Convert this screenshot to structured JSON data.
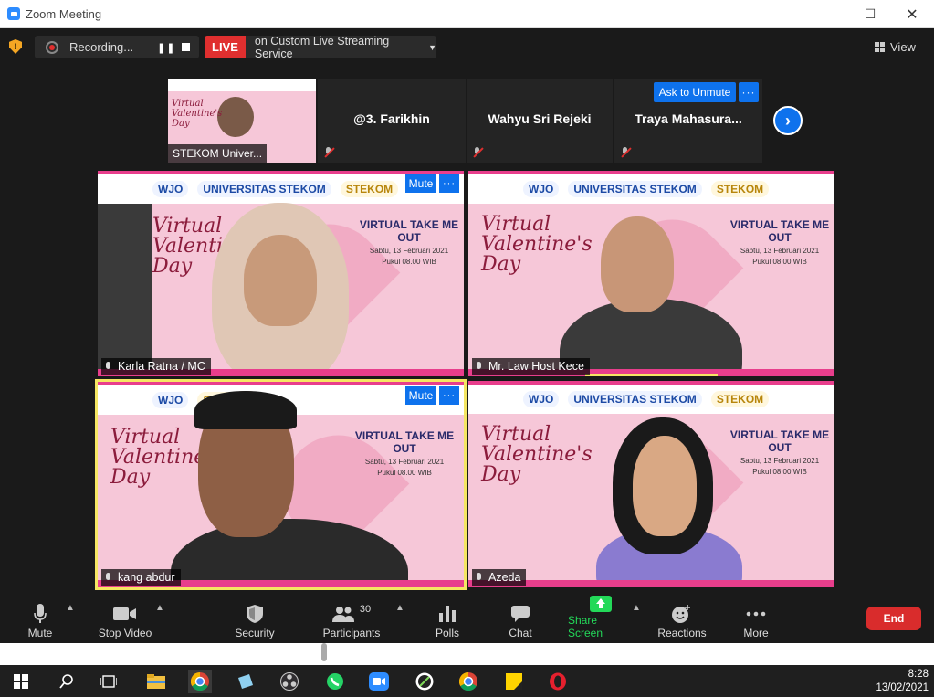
{
  "window": {
    "title": "Zoom Meeting"
  },
  "topbar": {
    "recording_label": "Recording...",
    "live_badge": "LIVE",
    "live_text": "on Custom Live Streaming Service",
    "view_label": "View"
  },
  "strip": {
    "tiles": [
      {
        "name": "STEKOM Univer..."
      },
      {
        "name": "@3. Farikhin"
      },
      {
        "name": "Wahyu Sri Rejeki"
      },
      {
        "name": "Traya  Mahasura..."
      }
    ],
    "ask_to_unmute": "Ask to Unmute"
  },
  "banner": {
    "logo_wjo": "WJO",
    "logo_univ": "UNIVERSITAS STEKOM",
    "logo_stekom": "STEKOM",
    "script": "Virtual Valentine's Day",
    "event_title": "VIRTUAL TAKE ME OUT",
    "event_date": "Sabtu, 13 Februari 2021",
    "event_time": "Pukul 08.00 WIB"
  },
  "videos": [
    {
      "name": "Karla Ratna / MC",
      "mute": "Mute"
    },
    {
      "name": "Mr. Law Host Kece"
    },
    {
      "name": "kang abdur",
      "mute": "Mute"
    },
    {
      "name": "Azeda"
    }
  ],
  "toolbar": {
    "mute": "Mute",
    "stop_video": "Stop Video",
    "security": "Security",
    "participants": "Participants",
    "participants_count": "30",
    "polls": "Polls",
    "chat": "Chat",
    "share_screen": "Share Screen",
    "reactions": "Reactions",
    "more": "More",
    "end": "End"
  },
  "taskbar": {
    "time": "8:28",
    "date": "13/02/2021"
  },
  "colors": {
    "zoom_blue": "#0e72ed",
    "live_red": "#e02f2f",
    "share_green": "#23d959",
    "end_red": "#d92c2c",
    "banner_pink": "#e83e8c"
  }
}
